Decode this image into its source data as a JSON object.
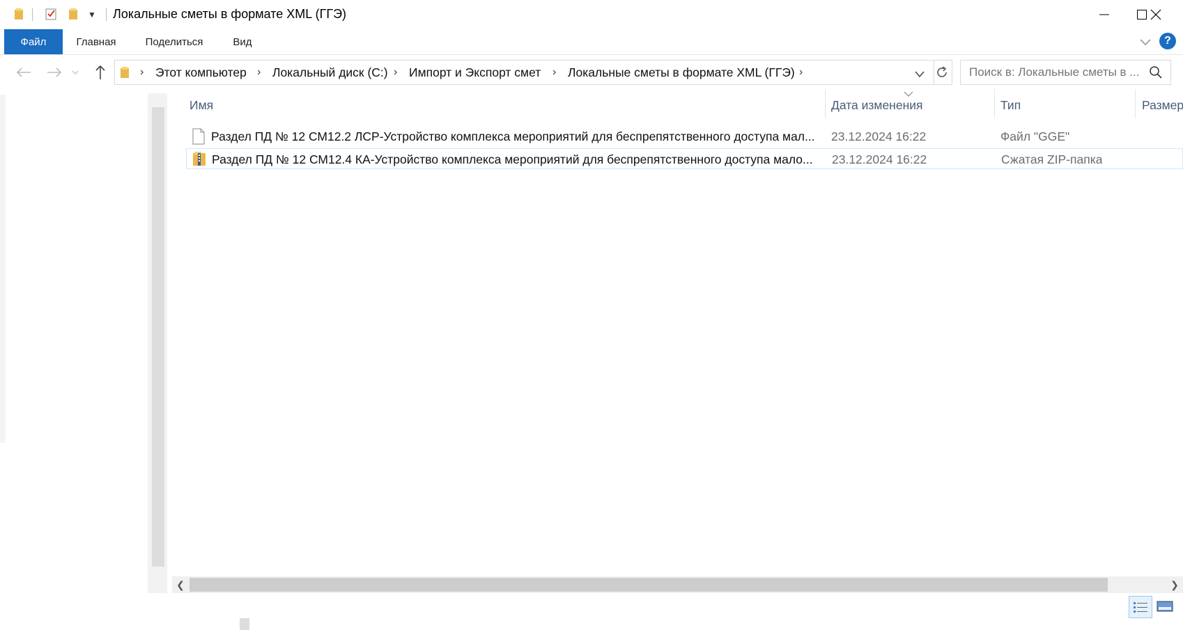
{
  "window": {
    "title": "Локальные сметы в формате XML (ГГЭ)",
    "minimize_icon": "minimize-icon",
    "maximize_icon": "maximize-icon",
    "close_icon": "close-icon"
  },
  "quick_access": {
    "icons": [
      "folder-icon",
      "properties-icon",
      "new-folder-icon",
      "customize-dropdown-icon"
    ]
  },
  "ribbon": {
    "tabs": [
      {
        "label": "Файл",
        "active": true
      },
      {
        "label": "Главная"
      },
      {
        "label": "Поделиться"
      },
      {
        "label": "Вид"
      }
    ],
    "expand_icon": "chevron-down-icon",
    "help_icon": "help-icon"
  },
  "nav": {
    "back_icon": "arrow-left-icon",
    "forward_icon": "arrow-right-icon",
    "recent_icon": "chevron-down-icon",
    "up_icon": "arrow-up-icon"
  },
  "address": {
    "crumbs": [
      "Этот компьютер",
      "Локальный диск (C:)",
      "Импорт и Экспорт смет",
      "Локальные сметы в формате XML (ГГЭ)"
    ]
  },
  "search": {
    "placeholder": "Поиск в: Локальные сметы в ..."
  },
  "columns": {
    "name": "Имя",
    "date": "Дата изменения",
    "type": "Тип",
    "size": "Размер"
  },
  "files": [
    {
      "name": "Раздел ПД № 12 СМ12.2 ЛСР-Устройство комплекса мероприятий для беспрепятственного доступа мал...",
      "date": "23.12.2024 16:22",
      "type": "Файл \"GGE\"",
      "icon": "file-icon"
    },
    {
      "name": "Раздел ПД № 12 СМ12.4 КА-Устройство комплекса мероприятий для беспрепятственного доступа мало...",
      "date": "23.12.2024 16:22",
      "type": "Сжатая ZIP-папка",
      "icon": "zip-folder-icon"
    }
  ],
  "colors": {
    "accent": "#1a6dc0",
    "selection_border": "#cce8ff",
    "header_text": "#4a5b7a"
  }
}
